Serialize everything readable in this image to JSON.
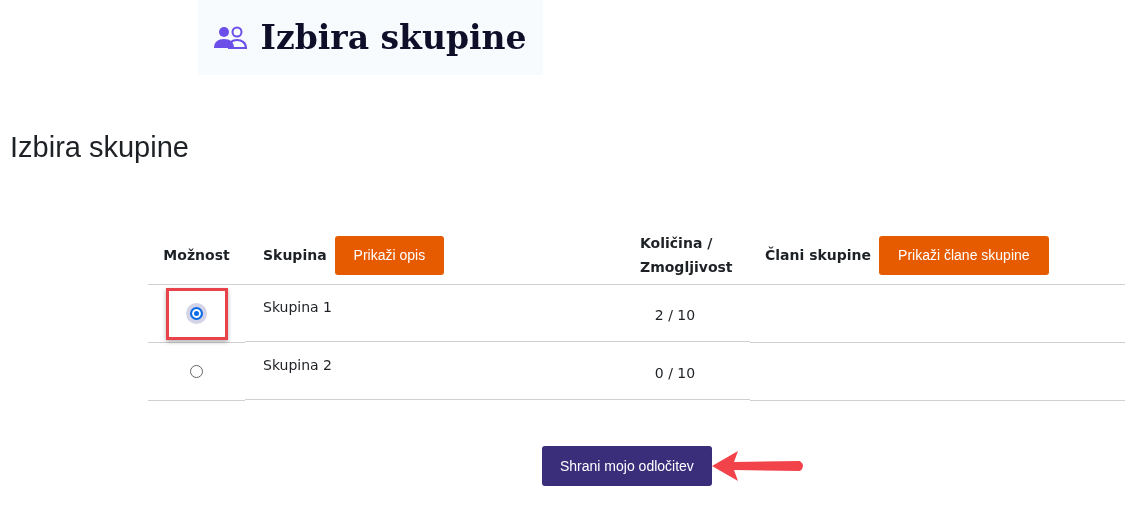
{
  "banner": {
    "title": "Izbira skupine"
  },
  "heading": "Izbira skupine",
  "table": {
    "columns": [
      {
        "label": "Možnost"
      },
      {
        "label": "Skupina",
        "button": "Prikaži opis"
      },
      {
        "label": "Količina / Zmogljivost"
      },
      {
        "label": "Člani skupine",
        "button": "Prikaži člane skupine"
      }
    ],
    "rows": [
      {
        "group": "Skupina 1",
        "count": "2 / 10",
        "selected": true,
        "highlighted": true
      },
      {
        "group": "Skupina 2",
        "count": "0 / 10",
        "selected": false,
        "highlighted": false
      }
    ]
  },
  "save_button": "Shrani mojo odločitev"
}
